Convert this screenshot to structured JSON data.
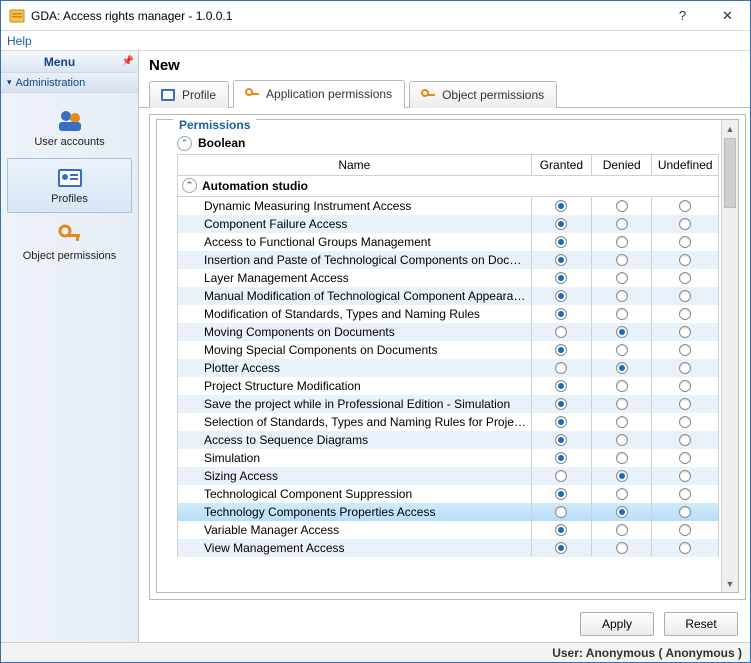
{
  "window": {
    "title": "GDA: Access rights manager - 1.0.0.1"
  },
  "menubar": {
    "help": "Help"
  },
  "sidebar": {
    "menu_label": "Menu",
    "section_label": "Administration",
    "items": [
      {
        "label": "User accounts"
      },
      {
        "label": "Profiles"
      },
      {
        "label": "Object permissions"
      }
    ]
  },
  "main": {
    "header": "New",
    "tabs": {
      "profile": "Profile",
      "app_perms": "Application permissions",
      "obj_perms": "Object permissions"
    },
    "panel_title": "Permissions",
    "tree": {
      "boolean_label": "Boolean",
      "group_label": "Automation studio"
    },
    "columns": {
      "name": "Name",
      "granted": "Granted",
      "denied": "Denied",
      "undefined": "Undefined"
    },
    "rows": [
      {
        "name": "Dynamic Measuring Instrument Access",
        "sel": "granted",
        "alt": false
      },
      {
        "name": "Component Failure Access",
        "sel": "granted",
        "alt": true
      },
      {
        "name": "Access to Functional Groups Management",
        "sel": "granted",
        "alt": false
      },
      {
        "name": "Insertion and Paste of Technological Components on Documents",
        "sel": "granted",
        "alt": true
      },
      {
        "name": "Layer Management Access",
        "sel": "granted",
        "alt": false
      },
      {
        "name": "Manual Modification of Technological Component Appearance",
        "sel": "granted",
        "alt": true
      },
      {
        "name": "Modification of Standards, Types and Naming Rules",
        "sel": "granted",
        "alt": false
      },
      {
        "name": "Moving Components on Documents",
        "sel": "denied",
        "alt": true
      },
      {
        "name": "Moving Special Components on Documents",
        "sel": "granted",
        "alt": false
      },
      {
        "name": "Plotter Access",
        "sel": "denied",
        "alt": true
      },
      {
        "name": "Project Structure Modification",
        "sel": "granted",
        "alt": false
      },
      {
        "name": "Save the project while in Professional Edition - Simulation",
        "sel": "granted",
        "alt": true
      },
      {
        "name": "Selection of Standards, Types and Naming Rules for Project and I",
        "sel": "granted",
        "alt": false
      },
      {
        "name": "Access to Sequence Diagrams",
        "sel": "granted",
        "alt": true
      },
      {
        "name": "Simulation",
        "sel": "granted",
        "alt": false
      },
      {
        "name": "Sizing Access",
        "sel": "denied",
        "alt": true
      },
      {
        "name": "Technological Component Suppression",
        "sel": "granted",
        "alt": false
      },
      {
        "name": "Technology Components Properties Access",
        "sel": "denied",
        "alt": true,
        "hl": true
      },
      {
        "name": "Variable Manager Access",
        "sel": "granted",
        "alt": false
      },
      {
        "name": "View Management Access",
        "sel": "granted",
        "alt": true
      }
    ],
    "buttons": {
      "apply": "Apply",
      "reset": "Reset"
    }
  },
  "status": {
    "text": "User: Anonymous ( Anonymous )"
  }
}
